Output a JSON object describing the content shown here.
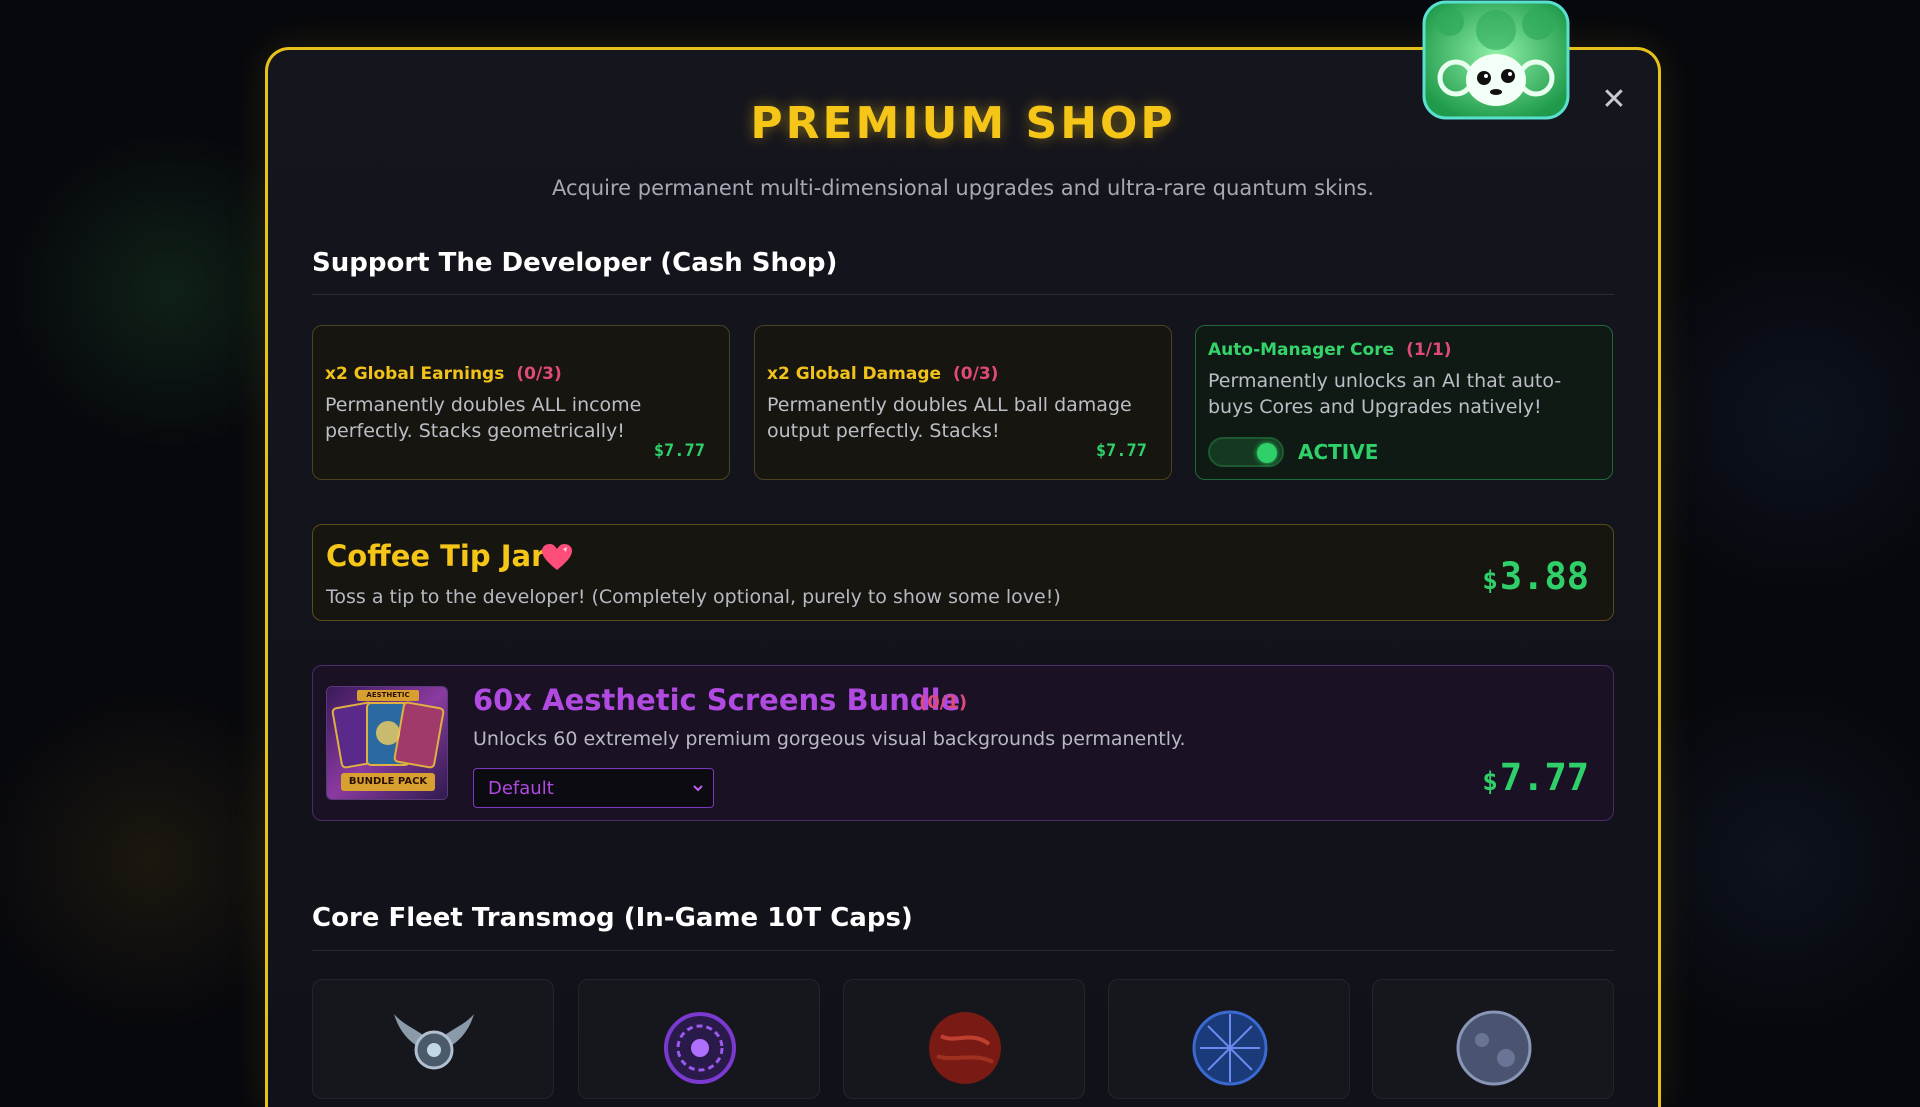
{
  "modal": {
    "title": "PREMIUM SHOP",
    "subtitle": "Acquire permanent multi-dimensional upgrades and ultra-rare quantum skins.",
    "close_label": "✕"
  },
  "cash_shop": {
    "section_title": "Support The Developer (Cash Shop)",
    "cards": [
      {
        "name": "x2 Global Earnings",
        "count": "(0/3)",
        "description": "Permanently doubles ALL income perfectly. Stacks geometrically!",
        "price": "$7.77"
      },
      {
        "name": "x2 Global Damage",
        "count": "(0/3)",
        "description": "Permanently doubles ALL ball damage output perfectly. Stacks!",
        "price": "$7.77"
      },
      {
        "name": "Auto-Manager Core",
        "count": "(1/1)",
        "description": "Permanently unlocks an AI that auto-buys Cores and Upgrades natively!",
        "status": "ACTIVE",
        "toggle_on": true
      }
    ],
    "tip_jar": {
      "title": "Coffee Tip Jar",
      "description": "Toss a tip to the developer! (Completely optional, purely to show some love!)",
      "currency": "$",
      "amount": "3.88"
    },
    "bundle": {
      "title": "60x Aesthetic Screens Bundle",
      "count": "(0/1)",
      "description": "Unlocks 60 extremely premium gorgeous visual backgrounds permanently.",
      "thumb_top_label": "AESTHETIC",
      "thumb_bottom_label": "BUNDLE PACK",
      "dropdown_value": "Default",
      "currency": "$",
      "amount": "7.77"
    }
  },
  "transmog": {
    "section_title": "Core Fleet Transmog (In-Game 10T Caps)",
    "skins": [
      {
        "icon": "winged-core-icon"
      },
      {
        "icon": "violet-rune-core-icon"
      },
      {
        "icon": "crimson-core-icon"
      },
      {
        "icon": "blue-planet-core-icon"
      },
      {
        "icon": "grey-planet-core-icon"
      }
    ]
  },
  "colors": {
    "accent_gold": "#f5c518",
    "price_green": "#2fd06a",
    "count_pink": "#e04a7a",
    "bundle_purple": "#b04ae0"
  }
}
